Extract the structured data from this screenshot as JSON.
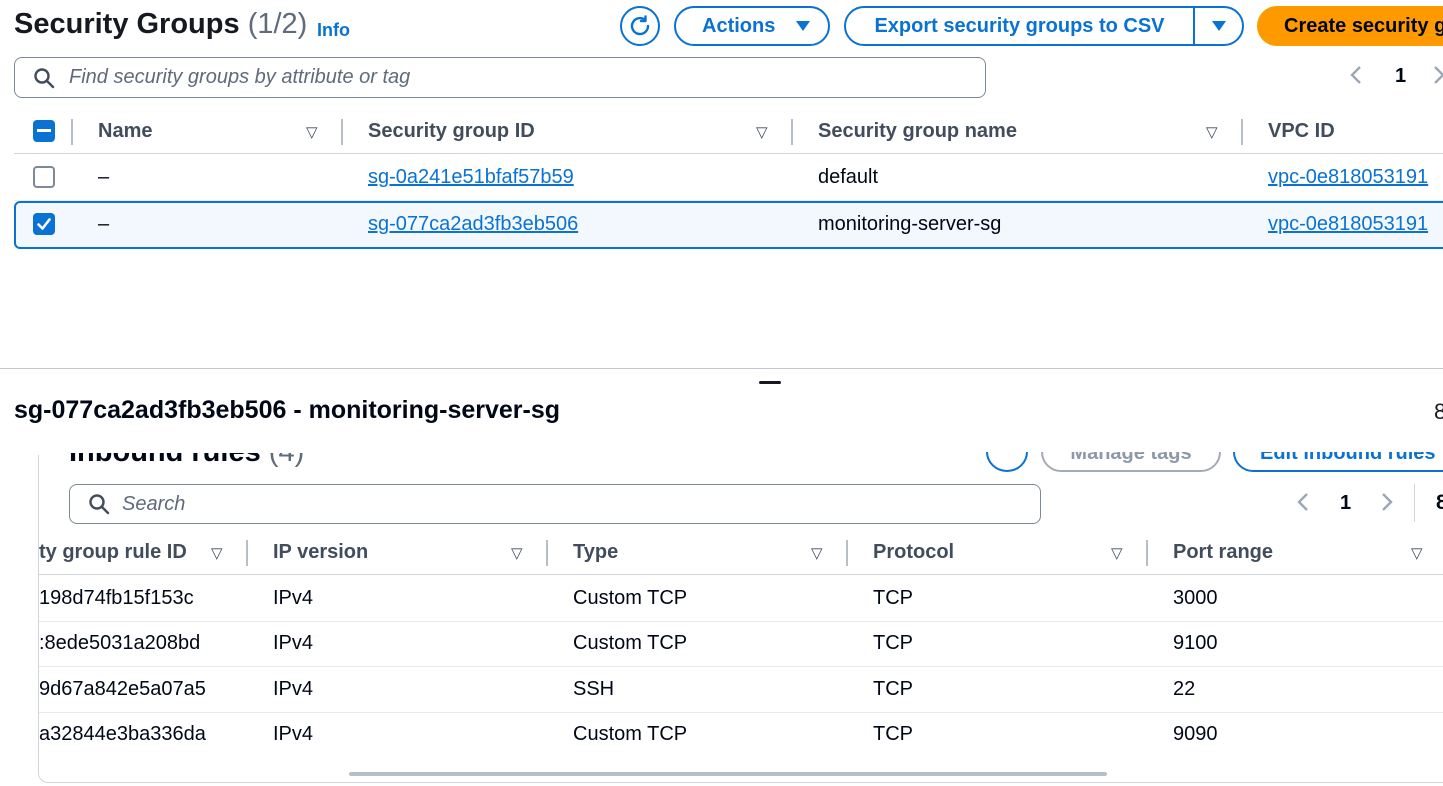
{
  "header": {
    "title": "Security Groups",
    "count": "(1/2)",
    "info": "Info",
    "actions_label": "Actions",
    "export_label": "Export security groups to CSV",
    "create_label": "Create security group",
    "search_placeholder": "Find security groups by attribute or tag",
    "page": "1"
  },
  "sg_table": {
    "columns": [
      "Name",
      "Security group ID",
      "Security group name",
      "VPC ID"
    ],
    "rows": [
      {
        "name": "–",
        "id": "sg-0a241e51bfaf57b59",
        "sg_name": "default",
        "vpc": "vpc-0e818053191",
        "selected": false
      },
      {
        "name": "–",
        "id": "sg-077ca2ad3fb3eb506",
        "sg_name": "monitoring-server-sg",
        "vpc": "vpc-0e818053191",
        "selected": true
      }
    ]
  },
  "detail": {
    "title": "sg-077ca2ad3fb3eb506 - monitoring-server-sg",
    "edge_glyph": "8",
    "inbound_title": "Inbound rules",
    "inbound_count": "(4)",
    "manage_tags": "Manage tags",
    "edit_inbound": "Edit inbound rules",
    "search_placeholder": "Search",
    "page": "1",
    "page_edge": "8",
    "columns": [
      "ty group rule ID",
      "IP version",
      "Type",
      "Protocol",
      "Port range"
    ],
    "rules": [
      {
        "rule_id": "198d74fb15f153c",
        "ip": "IPv4",
        "type": "Custom TCP",
        "protocol": "TCP",
        "port": "3000"
      },
      {
        "rule_id": ":8ede5031a208bd",
        "ip": "IPv4",
        "type": "Custom TCP",
        "protocol": "TCP",
        "port": "9100"
      },
      {
        "rule_id": "9d67a842e5a07a5",
        "ip": "IPv4",
        "type": "SSH",
        "protocol": "TCP",
        "port": "22"
      },
      {
        "rule_id": "a32844e3ba336da",
        "ip": "IPv4",
        "type": "Custom TCP",
        "protocol": "TCP",
        "port": "9090"
      }
    ]
  },
  "colors": {
    "accent": "#0972d3",
    "primary_button": "#ff9900",
    "selected_row_bg": "#f2f8fd"
  },
  "icons": [
    "refresh-icon",
    "caret-down-icon",
    "search-icon",
    "chevron-left-icon",
    "chevron-right-icon",
    "sort-icon",
    "checkmark-icon",
    "minus-icon"
  ]
}
